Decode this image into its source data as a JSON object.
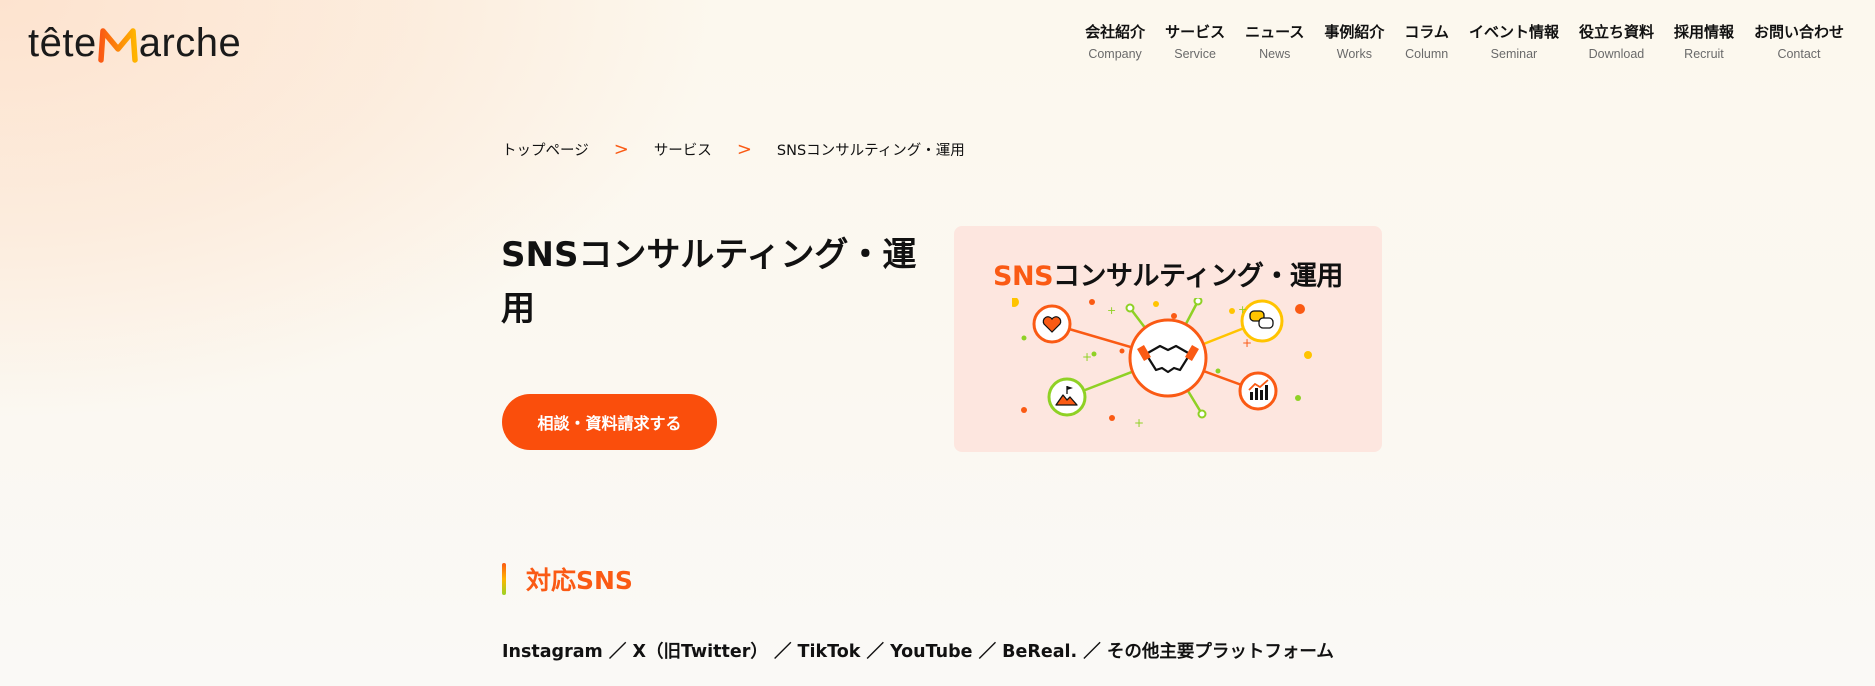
{
  "header": {
    "logo": {
      "left": "tête",
      "right": "arche"
    },
    "nav": [
      {
        "ja": "会社紹介",
        "en": "Company"
      },
      {
        "ja": "サービス",
        "en": "Service"
      },
      {
        "ja": "ニュース",
        "en": "News"
      },
      {
        "ja": "事例紹介",
        "en": "Works"
      },
      {
        "ja": "コラム",
        "en": "Column"
      },
      {
        "ja": "イベント情報",
        "en": "Seminar"
      },
      {
        "ja": "役立ち資料",
        "en": "Download"
      },
      {
        "ja": "採用情報",
        "en": "Recruit"
      },
      {
        "ja": "お問い合わせ",
        "en": "Contact"
      }
    ]
  },
  "breadcrumb": {
    "items": [
      "トップページ",
      "サービス",
      "SNSコンサルティング・運用"
    ],
    "separator": ">"
  },
  "hero": {
    "title": "SNSコンサルティング・運用",
    "cta_label": "相談・資料請求する",
    "card": {
      "accent": "SNS",
      "title": "コンサルティング・運用"
    }
  },
  "section": {
    "title": "対応SNS",
    "sns_list": "Instagram ／ X（旧Twitter） ／ TikTok ／ YouTube ／ BeReal. ／ その他主要プラットフォーム"
  },
  "colors": {
    "accent": "#fa5a14",
    "cta": "#fa4e0c",
    "card_bg": "#fde6df",
    "yellow": "#ffc400",
    "green": "#8fd125"
  }
}
